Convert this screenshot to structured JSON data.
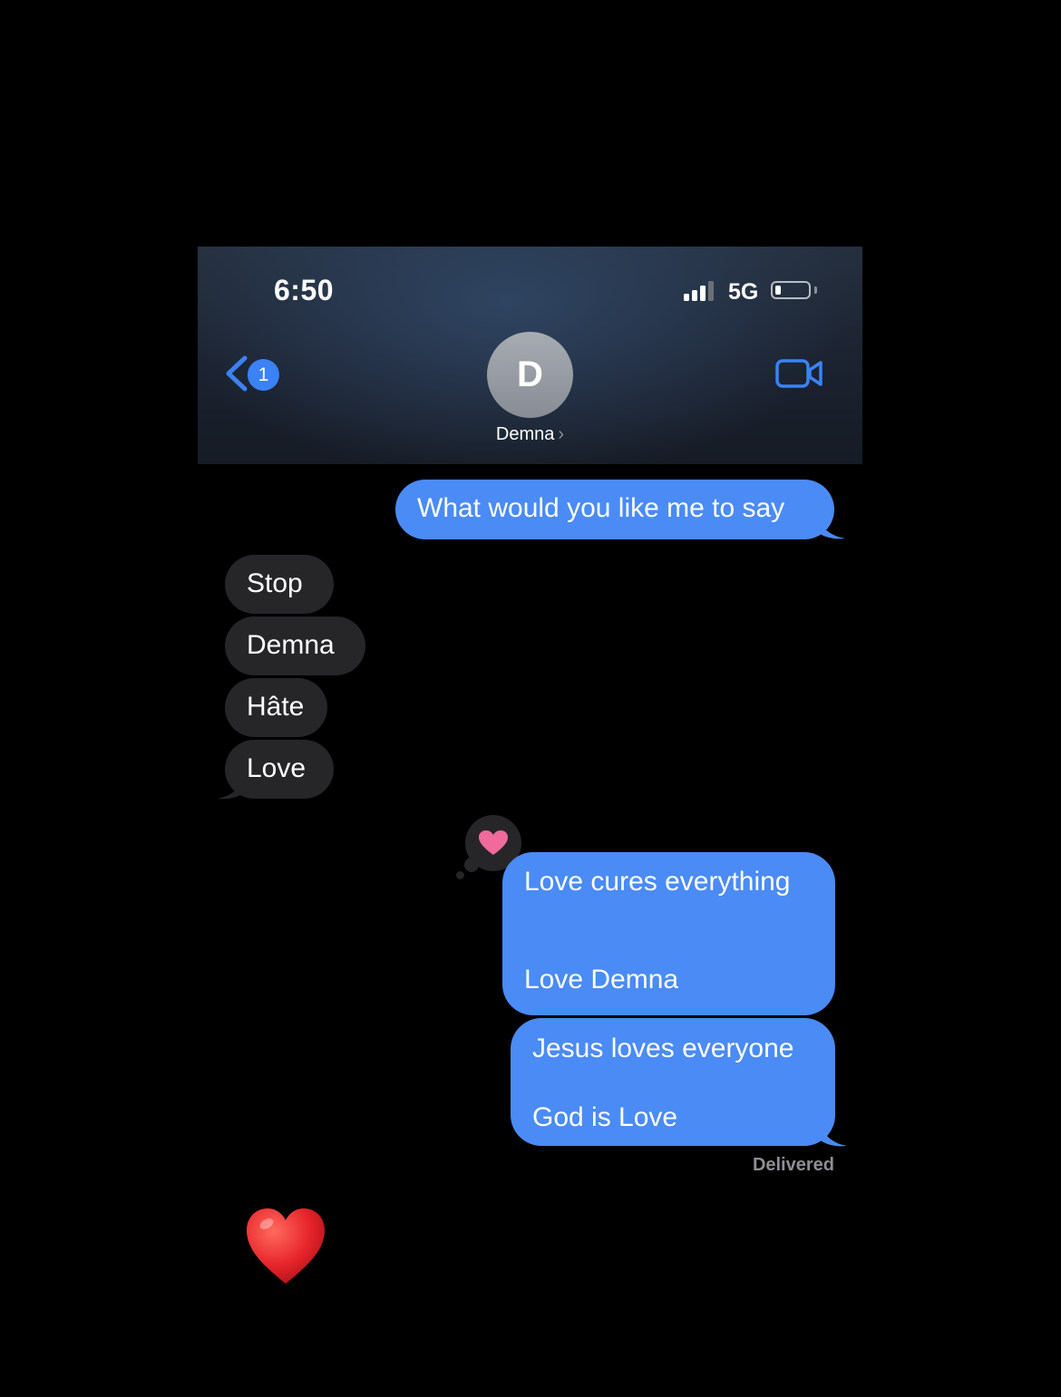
{
  "status_bar": {
    "time": "6:50",
    "network": "5G"
  },
  "header": {
    "back_badge": "1",
    "avatar_letter": "D",
    "contact_name": "Demna",
    "back_icon": "chevron-left-icon",
    "video_icon": "video-camera-icon",
    "accent_color": "#3b82f6"
  },
  "messages": [
    {
      "side": "sent",
      "text": "What would you like me to say"
    },
    {
      "side": "received",
      "text": "Stop"
    },
    {
      "side": "received",
      "text": "Demna"
    },
    {
      "side": "received",
      "text": "Hâte"
    },
    {
      "side": "received",
      "text": "Love"
    },
    {
      "side": "sent",
      "text": "Love cures everything\n\n\nLove Demna",
      "tapback": "heart"
    },
    {
      "side": "sent",
      "text": "Jesus loves everyone\n\nGod is Love"
    }
  ],
  "delivered_label": "Delivered",
  "colors": {
    "sent_bubble": "#4a8bf5",
    "received_bubble": "#262628",
    "tapback_heart": "#f06a9b",
    "emoji_heart": "#e8262c"
  }
}
